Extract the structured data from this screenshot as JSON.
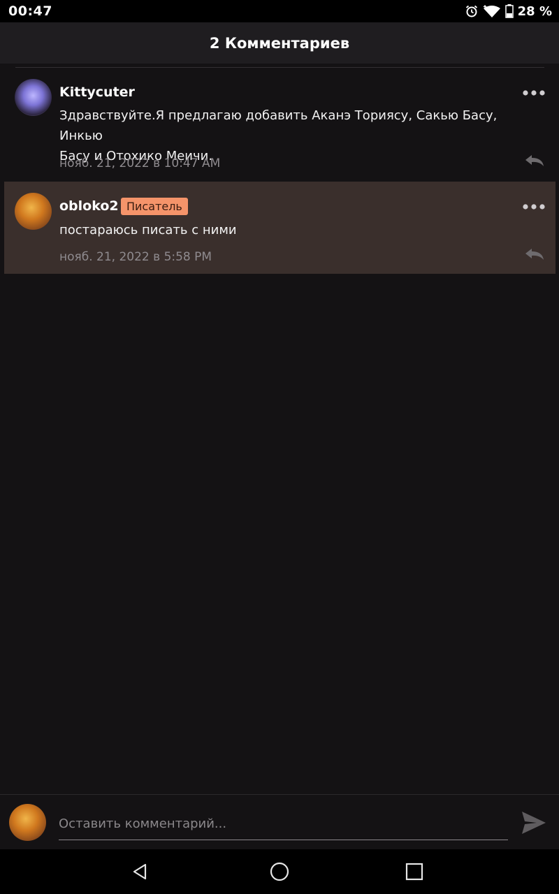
{
  "status_bar": {
    "time": "00:47",
    "battery_text": "28 %",
    "icons": [
      "alarm-icon",
      "wifi-icon",
      "battery-icon"
    ]
  },
  "header": {
    "title": "2 Комментариев"
  },
  "comments": [
    {
      "username": "Kittycuter",
      "text_line1": "Здравствуйте.Я предлагаю добавить Аканэ Ториясу, Сакью Басу, Инкью",
      "text_line2": "Басу и Отохико Меичи.",
      "timestamp": "нояб. 21, 2022 в 10:47 AM",
      "badge": "",
      "highlighted": false
    },
    {
      "username": "obloko2",
      "text_line1": "постараюсь писать с ними",
      "text_line2": "",
      "timestamp": "нояб. 21, 2022 в 5:58 PM",
      "badge": "Писатель",
      "highlighted": true
    }
  ],
  "input": {
    "placeholder": "Оставить комментарий...",
    "value": ""
  },
  "colors": {
    "background": "#141214",
    "header": "#1f1d20",
    "highlight": "#3a2f2c",
    "badge": "#f5946a",
    "muted": "#8f8b8f"
  },
  "nav": {
    "icons": [
      "back-icon",
      "home-icon",
      "recents-icon"
    ]
  }
}
